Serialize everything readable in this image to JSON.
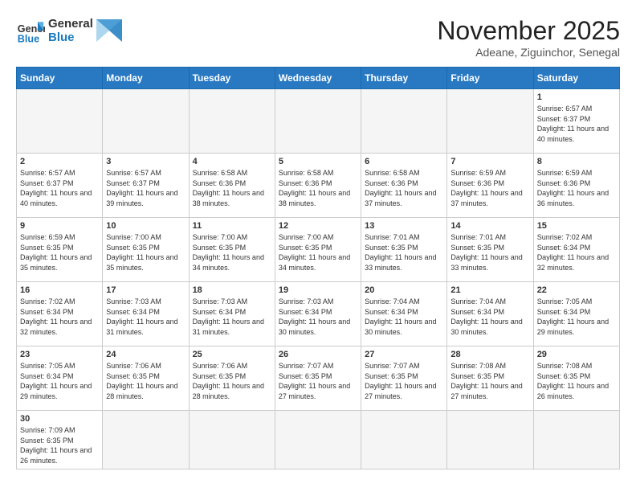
{
  "header": {
    "logo_general": "General",
    "logo_blue": "Blue",
    "title": "November 2025",
    "location": "Adeane, Ziguinchor, Senegal"
  },
  "days_of_week": [
    "Sunday",
    "Monday",
    "Tuesday",
    "Wednesday",
    "Thursday",
    "Friday",
    "Saturday"
  ],
  "weeks": [
    [
      {
        "day": "",
        "empty": true
      },
      {
        "day": "",
        "empty": true
      },
      {
        "day": "",
        "empty": true
      },
      {
        "day": "",
        "empty": true
      },
      {
        "day": "",
        "empty": true
      },
      {
        "day": "",
        "empty": true
      },
      {
        "day": "1",
        "sunrise": "6:57 AM",
        "sunset": "6:37 PM",
        "daylight": "11 hours and 40 minutes."
      }
    ],
    [
      {
        "day": "2",
        "sunrise": "6:57 AM",
        "sunset": "6:37 PM",
        "daylight": "11 hours and 40 minutes."
      },
      {
        "day": "3",
        "sunrise": "6:57 AM",
        "sunset": "6:37 PM",
        "daylight": "11 hours and 39 minutes."
      },
      {
        "day": "4",
        "sunrise": "6:58 AM",
        "sunset": "6:36 PM",
        "daylight": "11 hours and 38 minutes."
      },
      {
        "day": "5",
        "sunrise": "6:58 AM",
        "sunset": "6:36 PM",
        "daylight": "11 hours and 38 minutes."
      },
      {
        "day": "6",
        "sunrise": "6:58 AM",
        "sunset": "6:36 PM",
        "daylight": "11 hours and 37 minutes."
      },
      {
        "day": "7",
        "sunrise": "6:59 AM",
        "sunset": "6:36 PM",
        "daylight": "11 hours and 37 minutes."
      },
      {
        "day": "8",
        "sunrise": "6:59 AM",
        "sunset": "6:36 PM",
        "daylight": "11 hours and 36 minutes."
      }
    ],
    [
      {
        "day": "9",
        "sunrise": "6:59 AM",
        "sunset": "6:35 PM",
        "daylight": "11 hours and 35 minutes."
      },
      {
        "day": "10",
        "sunrise": "7:00 AM",
        "sunset": "6:35 PM",
        "daylight": "11 hours and 35 minutes."
      },
      {
        "day": "11",
        "sunrise": "7:00 AM",
        "sunset": "6:35 PM",
        "daylight": "11 hours and 34 minutes."
      },
      {
        "day": "12",
        "sunrise": "7:00 AM",
        "sunset": "6:35 PM",
        "daylight": "11 hours and 34 minutes."
      },
      {
        "day": "13",
        "sunrise": "7:01 AM",
        "sunset": "6:35 PM",
        "daylight": "11 hours and 33 minutes."
      },
      {
        "day": "14",
        "sunrise": "7:01 AM",
        "sunset": "6:35 PM",
        "daylight": "11 hours and 33 minutes."
      },
      {
        "day": "15",
        "sunrise": "7:02 AM",
        "sunset": "6:34 PM",
        "daylight": "11 hours and 32 minutes."
      }
    ],
    [
      {
        "day": "16",
        "sunrise": "7:02 AM",
        "sunset": "6:34 PM",
        "daylight": "11 hours and 32 minutes."
      },
      {
        "day": "17",
        "sunrise": "7:03 AM",
        "sunset": "6:34 PM",
        "daylight": "11 hours and 31 minutes."
      },
      {
        "day": "18",
        "sunrise": "7:03 AM",
        "sunset": "6:34 PM",
        "daylight": "11 hours and 31 minutes."
      },
      {
        "day": "19",
        "sunrise": "7:03 AM",
        "sunset": "6:34 PM",
        "daylight": "11 hours and 30 minutes."
      },
      {
        "day": "20",
        "sunrise": "7:04 AM",
        "sunset": "6:34 PM",
        "daylight": "11 hours and 30 minutes."
      },
      {
        "day": "21",
        "sunrise": "7:04 AM",
        "sunset": "6:34 PM",
        "daylight": "11 hours and 30 minutes."
      },
      {
        "day": "22",
        "sunrise": "7:05 AM",
        "sunset": "6:34 PM",
        "daylight": "11 hours and 29 minutes."
      }
    ],
    [
      {
        "day": "23",
        "sunrise": "7:05 AM",
        "sunset": "6:34 PM",
        "daylight": "11 hours and 29 minutes."
      },
      {
        "day": "24",
        "sunrise": "7:06 AM",
        "sunset": "6:35 PM",
        "daylight": "11 hours and 28 minutes."
      },
      {
        "day": "25",
        "sunrise": "7:06 AM",
        "sunset": "6:35 PM",
        "daylight": "11 hours and 28 minutes."
      },
      {
        "day": "26",
        "sunrise": "7:07 AM",
        "sunset": "6:35 PM",
        "daylight": "11 hours and 27 minutes."
      },
      {
        "day": "27",
        "sunrise": "7:07 AM",
        "sunset": "6:35 PM",
        "daylight": "11 hours and 27 minutes."
      },
      {
        "day": "28",
        "sunrise": "7:08 AM",
        "sunset": "6:35 PM",
        "daylight": "11 hours and 27 minutes."
      },
      {
        "day": "29",
        "sunrise": "7:08 AM",
        "sunset": "6:35 PM",
        "daylight": "11 hours and 26 minutes."
      }
    ],
    [
      {
        "day": "30",
        "sunrise": "7:09 AM",
        "sunset": "6:35 PM",
        "daylight": "11 hours and 26 minutes."
      },
      {
        "day": "",
        "empty": true
      },
      {
        "day": "",
        "empty": true
      },
      {
        "day": "",
        "empty": true
      },
      {
        "day": "",
        "empty": true
      },
      {
        "day": "",
        "empty": true
      },
      {
        "day": "",
        "empty": true
      }
    ]
  ],
  "labels": {
    "sunrise": "Sunrise:",
    "sunset": "Sunset:",
    "daylight": "Daylight:"
  }
}
